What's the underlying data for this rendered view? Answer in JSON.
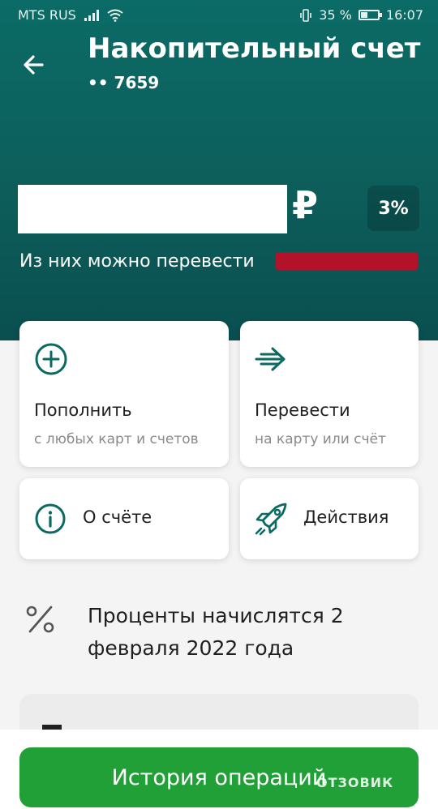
{
  "status_bar": {
    "carrier": "MTS RUS",
    "battery": "35 %",
    "battery_level": 0.35,
    "time": "16:07"
  },
  "header": {
    "title": "Накопительный счет",
    "account_mask": "•• 7659"
  },
  "balance": {
    "currency_symbol": "₽",
    "rate": "3%",
    "available_label": "Из них можно перевести"
  },
  "actions": {
    "top_up": {
      "label": "Пополнить",
      "sub": "с любых карт и счетов"
    },
    "transfer": {
      "label": "Перевести",
      "sub": "на карту или счёт"
    },
    "about": {
      "label": "О счёте"
    },
    "operations": {
      "label": "Действия"
    }
  },
  "interest_note": "Проценты начислятся 2 февраля 2022 года",
  "history_button": "История операций",
  "watermark": "ОТЗОВИК",
  "colors": {
    "header": "#0b6b66",
    "accent": "#21a038",
    "icon": "#0a6a62",
    "redaction": "#b3132a"
  },
  "icons": [
    "back-arrow",
    "plus-circle",
    "send-arrow",
    "info-circle",
    "rocket",
    "percent"
  ]
}
